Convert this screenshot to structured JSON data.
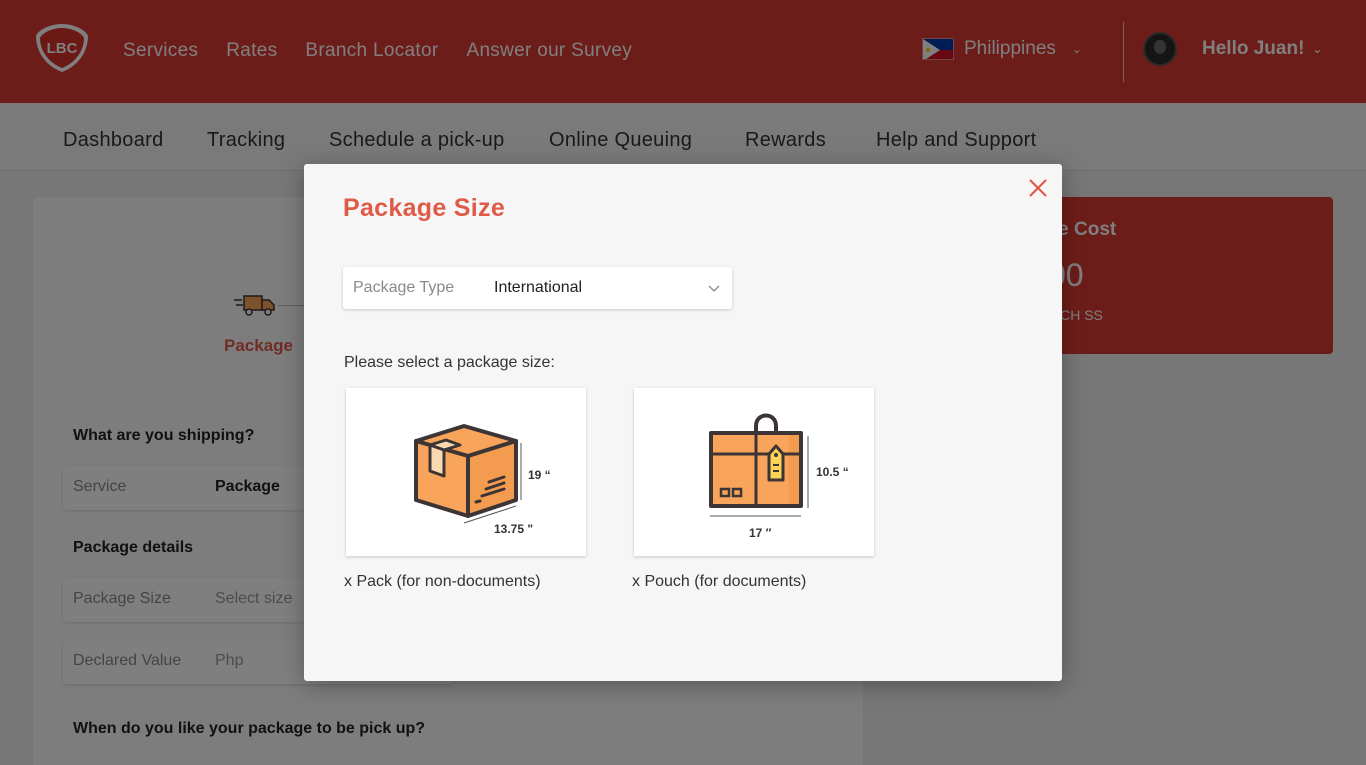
{
  "header": {
    "nav": [
      "Services",
      "Rates",
      "Branch Locator",
      "Answer our Survey"
    ],
    "country": "Philippines",
    "greeting": "Hello Juan!"
  },
  "subnav": [
    "Dashboard",
    "Tracking",
    "Schedule a pick-up",
    "Online Queuing",
    "Rewards",
    "Help and Support"
  ],
  "page": {
    "step_label": "Package",
    "section_shipping": "What are you shipping?",
    "service_label": "Service",
    "service_value": "Package",
    "section_details": "Package details",
    "size_label": "Package Size",
    "size_placeholder": "Select size",
    "declared_label": "Declared Value",
    "declared_placeholder": "Php",
    "section_pickup": "When do you like your package to be pick up?",
    "cost_title": "age Cost",
    "cost_value": "00",
    "cost_sub": "UCH SS"
  },
  "modal": {
    "title": "Package Size",
    "select_label": "Package Type",
    "select_value": "International",
    "prompt": "Please select a package size:",
    "options": [
      {
        "caption": "x Pack (for non-documents)",
        "height": "19 “",
        "width": "13.75 \""
      },
      {
        "caption": "x Pouch (for documents)",
        "height": "10.5 “",
        "width": "17 ″"
      }
    ]
  },
  "colors": {
    "brand": "#da3b33",
    "accent": "#e05a48",
    "box": "#f8a55b",
    "outline": "#3d3535"
  }
}
